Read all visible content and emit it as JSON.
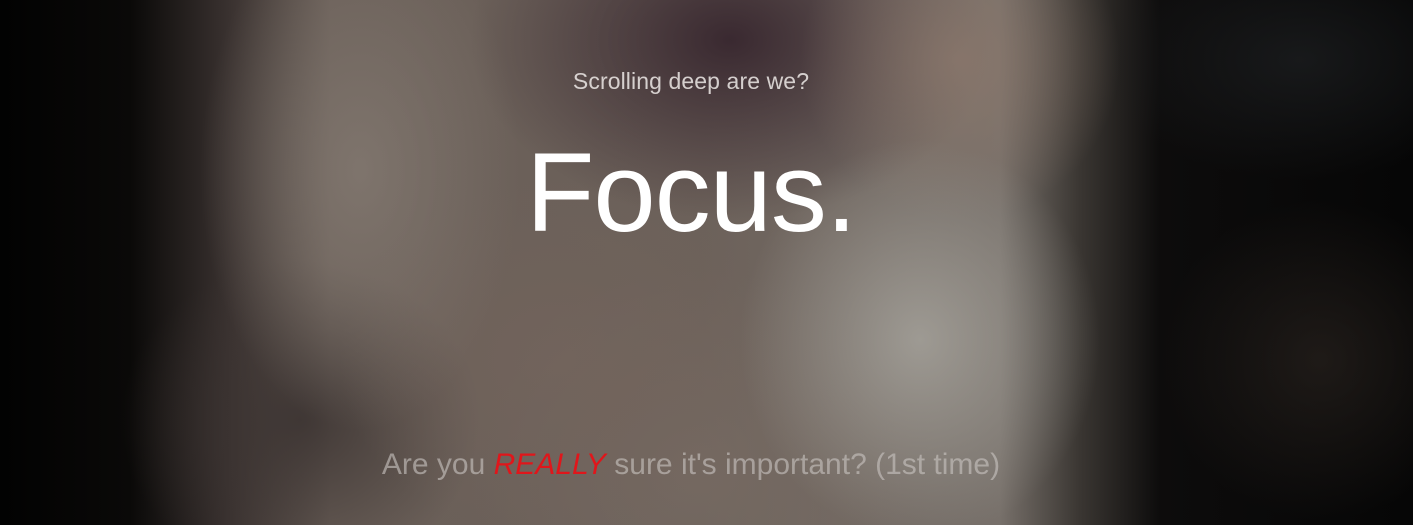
{
  "overlay": {
    "subtitle": "Scrolling deep are we?",
    "headline": "Focus.",
    "question": {
      "prefix": "Are you ",
      "emphasis": "REALLY",
      "suffix": " sure it's important? (1st time)"
    }
  },
  "colors": {
    "emphasis": "#e0161b",
    "headline": "#ffffff"
  }
}
